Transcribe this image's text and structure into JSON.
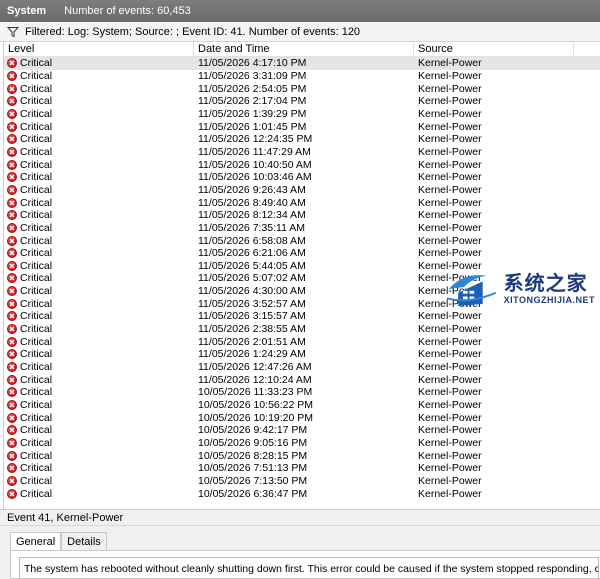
{
  "header": {
    "title": "System",
    "count_text": "Number of events: 60,453"
  },
  "filter": {
    "icon": "filter-icon",
    "text": "Filtered: Log: System; Source: ; Event ID: 41. Number of events: 120"
  },
  "grid": {
    "columns": [
      "Level",
      "Date and Time",
      "Source"
    ],
    "rows": [
      {
        "level": "Critical",
        "datetime": "11/05/2026 4:17:10 PM",
        "source": "Kernel-Power"
      },
      {
        "level": "Critical",
        "datetime": "11/05/2026 3:31:09 PM",
        "source": "Kernel-Power"
      },
      {
        "level": "Critical",
        "datetime": "11/05/2026 2:54:05 PM",
        "source": "Kernel-Power"
      },
      {
        "level": "Critical",
        "datetime": "11/05/2026 2:17:04 PM",
        "source": "Kernel-Power"
      },
      {
        "level": "Critical",
        "datetime": "11/05/2026 1:39:29 PM",
        "source": "Kernel-Power"
      },
      {
        "level": "Critical",
        "datetime": "11/05/2026 1:01:45 PM",
        "source": "Kernel-Power"
      },
      {
        "level": "Critical",
        "datetime": "11/05/2026 12:24:35 PM",
        "source": "Kernel-Power"
      },
      {
        "level": "Critical",
        "datetime": "11/05/2026 11:47:29 AM",
        "source": "Kernel-Power"
      },
      {
        "level": "Critical",
        "datetime": "11/05/2026 10:40:50 AM",
        "source": "Kernel-Power"
      },
      {
        "level": "Critical",
        "datetime": "11/05/2026 10:03:46 AM",
        "source": "Kernel-Power"
      },
      {
        "level": "Critical",
        "datetime": "11/05/2026 9:26:43 AM",
        "source": "Kernel-Power"
      },
      {
        "level": "Critical",
        "datetime": "11/05/2026 8:49:40 AM",
        "source": "Kernel-Power"
      },
      {
        "level": "Critical",
        "datetime": "11/05/2026 8:12:34 AM",
        "source": "Kernel-Power"
      },
      {
        "level": "Critical",
        "datetime": "11/05/2026 7:35:11 AM",
        "source": "Kernel-Power"
      },
      {
        "level": "Critical",
        "datetime": "11/05/2026 6:58:08 AM",
        "source": "Kernel-Power"
      },
      {
        "level": "Critical",
        "datetime": "11/05/2026 6:21:06 AM",
        "source": "Kernel-Power"
      },
      {
        "level": "Critical",
        "datetime": "11/05/2026 5:44:05 AM",
        "source": "Kernel-Power"
      },
      {
        "level": "Critical",
        "datetime": "11/05/2026 5:07:02 AM",
        "source": "Kernel-Power"
      },
      {
        "level": "Critical",
        "datetime": "11/05/2026 4:30:00 AM",
        "source": "Kernel-Power"
      },
      {
        "level": "Critical",
        "datetime": "11/05/2026 3:52:57 AM",
        "source": "Kernel-Power"
      },
      {
        "level": "Critical",
        "datetime": "11/05/2026 3:15:57 AM",
        "source": "Kernel-Power"
      },
      {
        "level": "Critical",
        "datetime": "11/05/2026 2:38:55 AM",
        "source": "Kernel-Power"
      },
      {
        "level": "Critical",
        "datetime": "11/05/2026 2:01:51 AM",
        "source": "Kernel-Power"
      },
      {
        "level": "Critical",
        "datetime": "11/05/2026 1:24:29 AM",
        "source": "Kernel-Power"
      },
      {
        "level": "Critical",
        "datetime": "11/05/2026 12:47:26 AM",
        "source": "Kernel-Power"
      },
      {
        "level": "Critical",
        "datetime": "11/05/2026 12:10:24 AM",
        "source": "Kernel-Power"
      },
      {
        "level": "Critical",
        "datetime": "10/05/2026 11:33:23 PM",
        "source": "Kernel-Power"
      },
      {
        "level": "Critical",
        "datetime": "10/05/2026 10:56:22 PM",
        "source": "Kernel-Power"
      },
      {
        "level": "Critical",
        "datetime": "10/05/2026 10:19:20 PM",
        "source": "Kernel-Power"
      },
      {
        "level": "Critical",
        "datetime": "10/05/2026 9:42:17 PM",
        "source": "Kernel-Power"
      },
      {
        "level": "Critical",
        "datetime": "10/05/2026 9:05:16 PM",
        "source": "Kernel-Power"
      },
      {
        "level": "Critical",
        "datetime": "10/05/2026 8:28:15 PM",
        "source": "Kernel-Power"
      },
      {
        "level": "Critical",
        "datetime": "10/05/2026 7:51:13 PM",
        "source": "Kernel-Power"
      },
      {
        "level": "Critical",
        "datetime": "10/05/2026 7:13:50 PM",
        "source": "Kernel-Power"
      },
      {
        "level": "Critical",
        "datetime": "10/05/2026 6:36:47 PM",
        "source": "Kernel-Power"
      }
    ],
    "selected_index": 0,
    "critical_icon": "critical-error-icon",
    "critical_color": "#c8191b"
  },
  "detail": {
    "title": "Event 41, Kernel-Power",
    "tabs": [
      "General",
      "Details"
    ],
    "active_tab": 0,
    "message": "The system has rebooted without cleanly shutting down first. This error could be caused if the system stopped responding, crashed, or lost power unexpectedly."
  },
  "watermark": {
    "cn": "系统之家",
    "en": "XITONGZHIJIA.NET"
  }
}
